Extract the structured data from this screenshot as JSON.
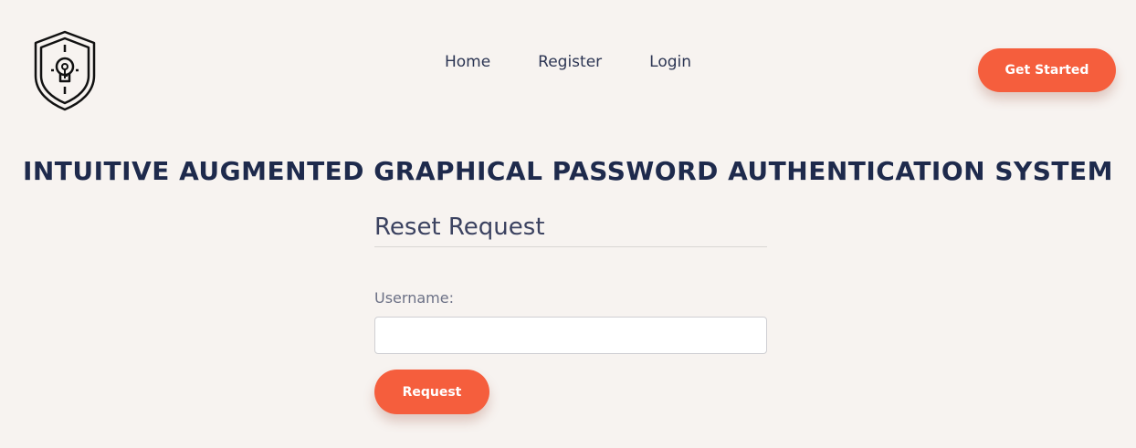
{
  "brand": {
    "logo_icon": "shield-keyhole-icon"
  },
  "nav": {
    "items": [
      {
        "label": "Home"
      },
      {
        "label": "Register"
      },
      {
        "label": "Login"
      }
    ]
  },
  "header": {
    "cta_label": "Get Started"
  },
  "page": {
    "title": "INTUITIVE AUGMENTED GRAPHICAL PASSWORD AUTHENTICATION SYSTEM"
  },
  "form": {
    "heading": "Reset Request",
    "username_label": "Username:",
    "username_value": "",
    "submit_label": "Request"
  },
  "colors": {
    "accent": "#f55e3d",
    "background": "#f7f3f0",
    "title": "#1e2a4c"
  }
}
